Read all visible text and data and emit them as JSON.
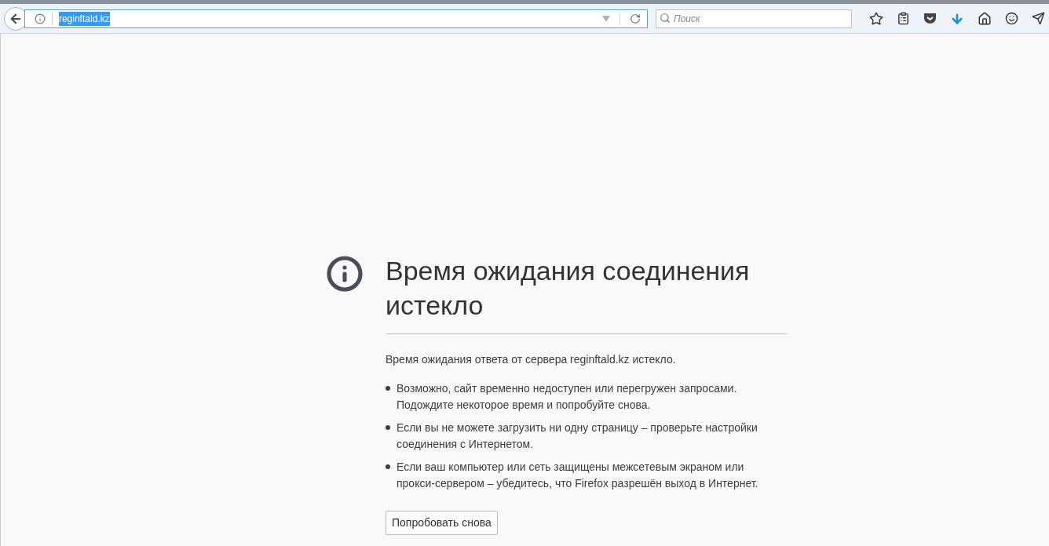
{
  "address_bar": {
    "url": "reginftald.kz",
    "url_selected": true
  },
  "search": {
    "placeholder": "Поиск"
  },
  "error": {
    "title": "Время ожидания соединения истекло",
    "message": "Время ожидания ответа от сервера reginftald.kz истекло.",
    "bullets": [
      "Возможно, сайт временно недоступен или перегружен запросами. Подождите некоторое время и попробуйте снова.",
      "Если вы не можете загрузить ни одну страницу – проверьте настройки соединения с Интернетом.",
      "Если ваш компьютер или сеть защищены межсетевым экраном или прокси-сервером – убедитесь, что Firefox разрешён выход в Интернет."
    ],
    "button": "Попробовать снова"
  }
}
